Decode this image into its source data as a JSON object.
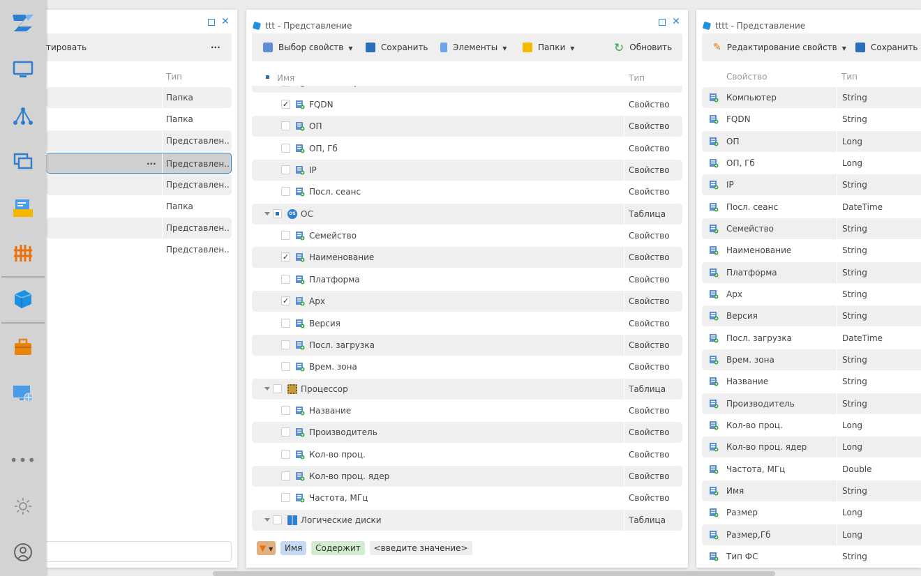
{
  "left_panel": {
    "toolbar_label": "тировать",
    "more_label": "···",
    "header_type": "Тип",
    "rows": [
      {
        "type": "Папка"
      },
      {
        "type": "Папка"
      },
      {
        "type": "Представлен..."
      },
      {
        "type": "Представлен...",
        "more": "···"
      },
      {
        "type": "Представлен..."
      },
      {
        "type": "Папка"
      },
      {
        "type": "Представлен..."
      },
      {
        "type": "Представлен..."
      }
    ]
  },
  "mid_panel": {
    "title": "ttt - Представление",
    "toolbar": {
      "select_props": "Выбор свойств",
      "save": "Сохранить",
      "elements": "Элементы",
      "folders": "Папки",
      "refresh": "Обновить"
    },
    "header": {
      "name": "Имя",
      "type": "Тип"
    },
    "partial_row": {
      "name": "Компьютер",
      "type": "Свойство"
    },
    "rows": [
      {
        "name": "FQDN",
        "type": "Свойство",
        "checked": "✓"
      },
      {
        "name": "ОП",
        "type": "Свойство",
        "checked": ""
      },
      {
        "name": "ОП, Гб",
        "type": "Свойство",
        "checked": ""
      },
      {
        "name": "IP",
        "type": "Свойство",
        "checked": ""
      },
      {
        "name": "Посл. сеанс",
        "type": "Свойство",
        "checked": ""
      },
      {
        "name": "ОС",
        "type": "Таблица",
        "group": true,
        "icon": "os-icon",
        "partial": true
      },
      {
        "name": "Семейство",
        "type": "Свойство",
        "checked": ""
      },
      {
        "name": "Наименование",
        "type": "Свойство",
        "checked": "✓"
      },
      {
        "name": "Платформа",
        "type": "Свойство",
        "checked": ""
      },
      {
        "name": "Арх",
        "type": "Свойство",
        "checked": "✓"
      },
      {
        "name": "Версия",
        "type": "Свойство",
        "checked": ""
      },
      {
        "name": "Посл. загрузка",
        "type": "Свойство",
        "checked": ""
      },
      {
        "name": "Врем. зона",
        "type": "Свойство",
        "checked": ""
      },
      {
        "name": "Процессор",
        "type": "Таблица",
        "group": true,
        "icon": "cpu-icon"
      },
      {
        "name": "Название",
        "type": "Свойство",
        "checked": ""
      },
      {
        "name": "Производитель",
        "type": "Свойство",
        "checked": ""
      },
      {
        "name": "Кол-во проц.",
        "type": "Свойство",
        "checked": ""
      },
      {
        "name": "Кол-во проц. ядер",
        "type": "Свойство",
        "checked": ""
      },
      {
        "name": "Частота, МГц",
        "type": "Свойство",
        "checked": ""
      },
      {
        "name": "Логические диски",
        "type": "Таблица",
        "group": true,
        "icon": "windows-icon"
      }
    ],
    "filter": {
      "field": "Имя",
      "op": "Содержит",
      "value": "<введите значение>"
    }
  },
  "right_panel": {
    "title": "tttt - Представление",
    "toolbar": {
      "edit_props": "Редактирование свойств",
      "save": "Сохранить"
    },
    "header": {
      "prop": "Свойство",
      "type": "Тип"
    },
    "rows": [
      {
        "name": "Компьютер",
        "type": "String"
      },
      {
        "name": "FQDN",
        "type": "String"
      },
      {
        "name": "ОП",
        "type": "Long"
      },
      {
        "name": "ОП, Гб",
        "type": "Long"
      },
      {
        "name": "IP",
        "type": "String"
      },
      {
        "name": "Посл. сеанс",
        "type": "DateTime"
      },
      {
        "name": "Семейство",
        "type": "String"
      },
      {
        "name": "Наименование",
        "type": "String"
      },
      {
        "name": "Платформа",
        "type": "String"
      },
      {
        "name": "Арх",
        "type": "String"
      },
      {
        "name": "Версия",
        "type": "String"
      },
      {
        "name": "Посл. загрузка",
        "type": "DateTime"
      },
      {
        "name": "Врем. зона",
        "type": "String"
      },
      {
        "name": "Название",
        "type": "String"
      },
      {
        "name": "Производитель",
        "type": "String"
      },
      {
        "name": "Кол-во проц.",
        "type": "Long"
      },
      {
        "name": "Кол-во проц. ядер",
        "type": "Long"
      },
      {
        "name": "Частота, МГц",
        "type": "Double"
      },
      {
        "name": "Имя",
        "type": "String"
      },
      {
        "name": "Размер",
        "type": "Long"
      },
      {
        "name": "Размер,Гб",
        "type": "Long"
      },
      {
        "name": "Тип ФС",
        "type": "String"
      }
    ]
  },
  "rail": {
    "items": [
      "logo-icon",
      "monitor-icon",
      "network-icon",
      "windows-icon",
      "inbox-icon",
      "firewall-icon",
      "cube-icon",
      "toolbox-icon",
      "remote-desktop-icon",
      "more-icon",
      "settings-icon",
      "user-icon"
    ]
  },
  "colors": {
    "accent": "#2a8ad6",
    "stripe": "#efefef",
    "rail": "#d3d3d3"
  }
}
